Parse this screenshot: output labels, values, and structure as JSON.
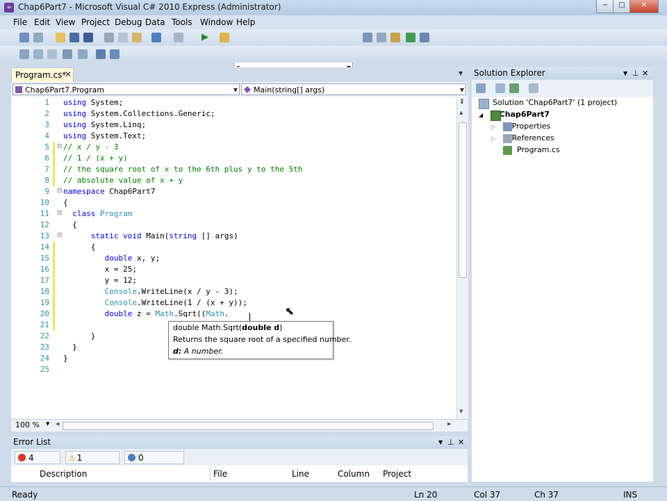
{
  "window": {
    "title": "Chap6Part7 - Microsoft Visual C# 2010 Express (Administrator)",
    "minimize_glyph": "−",
    "maximize_glyph": "□",
    "close_glyph": "✕"
  },
  "menu": [
    "File",
    "Edit",
    "View",
    "Project",
    "Debug",
    "Data",
    "Tools",
    "Window",
    "Help"
  ],
  "toolbar": {
    "find_combo_value": "c"
  },
  "document": {
    "tab_label": "Program.cs*",
    "tab_close": "✕",
    "type_dropdown": "Chap6Part7.Program",
    "member_dropdown": "Main(string[] args)",
    "zoom": "100 %"
  },
  "code_lines": [
    {
      "n": "1",
      "parts": [
        [
          "kw",
          "using"
        ],
        [
          "",
          "System;"
        ]
      ]
    },
    {
      "n": "2",
      "parts": [
        [
          "kw",
          "using"
        ],
        [
          "",
          "System.Collections.Generic;"
        ]
      ]
    },
    {
      "n": "3",
      "parts": [
        [
          "kw",
          "using"
        ],
        [
          "",
          "System.Linq;"
        ]
      ]
    },
    {
      "n": "4",
      "parts": [
        [
          "kw",
          "using"
        ],
        [
          "",
          "System.Text;"
        ]
      ]
    },
    {
      "n": "5",
      "parts": [
        [
          "cm",
          "// x / y - 3"
        ]
      ]
    },
    {
      "n": "6",
      "parts": [
        [
          "cm",
          "// 1 / (x + y)"
        ]
      ]
    },
    {
      "n": "7",
      "parts": [
        [
          "cm",
          "// the square root of x to the 6th plus y to the 5th"
        ]
      ]
    },
    {
      "n": "8",
      "parts": [
        [
          "cm",
          "// absolute value of x + y"
        ]
      ]
    },
    {
      "n": "9",
      "parts": [
        [
          "kw",
          "namespace"
        ],
        [
          "",
          " Chap6Part7"
        ]
      ]
    },
    {
      "n": "10",
      "parts": [
        [
          "",
          "{"
        ]
      ]
    },
    {
      "n": "11",
      "parts": [
        [
          "",
          "  "
        ],
        [
          "kw",
          "class"
        ],
        [
          "ty",
          " Program"
        ]
      ]
    },
    {
      "n": "12",
      "parts": [
        [
          "",
          "  {"
        ]
      ]
    },
    {
      "n": "13",
      "parts": [
        [
          "",
          "      "
        ],
        [
          "kw",
          "static void"
        ],
        [
          "",
          " Main("
        ],
        [
          "kw",
          "string"
        ],
        [
          "",
          "[] args)"
        ]
      ]
    },
    {
      "n": "14",
      "parts": [
        [
          "",
          "      {"
        ]
      ]
    },
    {
      "n": "15",
      "parts": [
        [
          "",
          "         "
        ],
        [
          "kw",
          "double"
        ],
        [
          "",
          " x, y;"
        ]
      ]
    },
    {
      "n": "16",
      "parts": [
        [
          "",
          "         x = 25;"
        ]
      ]
    },
    {
      "n": "17",
      "parts": [
        [
          "",
          "         y = 12;"
        ]
      ]
    },
    {
      "n": "18",
      "parts": [
        [
          "",
          "         "
        ],
        [
          "ty",
          "Console"
        ],
        [
          "",
          ".WriteLine(x / y - 3);"
        ]
      ]
    },
    {
      "n": "19",
      "parts": [
        [
          "",
          "         "
        ],
        [
          "ty",
          "Console"
        ],
        [
          "",
          ".WriteLine(1 / (x + y));"
        ]
      ]
    },
    {
      "n": "20",
      "parts": [
        [
          "",
          "         "
        ],
        [
          "kw",
          "double"
        ],
        [
          "",
          " z = "
        ],
        [
          "ty",
          "Math"
        ],
        [
          "",
          ".Sqrt(("
        ],
        [
          "ty",
          "Math"
        ],
        [
          "",
          "."
        ]
      ]
    },
    {
      "n": "21",
      "parts": [
        [
          "",
          ""
        ]
      ]
    },
    {
      "n": "22",
      "parts": [
        [
          "",
          "      }"
        ]
      ]
    },
    {
      "n": "23",
      "parts": [
        [
          "",
          "  }"
        ]
      ]
    },
    {
      "n": "24",
      "parts": [
        [
          "",
          "}"
        ]
      ]
    },
    {
      "n": "25",
      "parts": [
        [
          "",
          ""
        ]
      ]
    }
  ],
  "tooltip": {
    "signature_prefix": "double Math.Sqrt(",
    "signature_param": "double d",
    "signature_suffix": ")",
    "description": "Returns the square root of a specified number.",
    "param_name": "d:",
    "param_desc": " A number."
  },
  "solution_explorer": {
    "title": "Solution Explorer",
    "solution": "Solution 'Chap6Part7' (1 project)",
    "project": "Chap6Part7",
    "items": [
      "Properties",
      "References",
      "Program.cs"
    ]
  },
  "error_list": {
    "title": "Error List",
    "errors": "4 Errors",
    "warnings": "1 Warning",
    "messages": "0 Messages",
    "columns": [
      "Description",
      "File",
      "Line",
      "Column",
      "Project"
    ]
  },
  "status": {
    "ready": "Ready",
    "line": "Ln 20",
    "col": "Col 37",
    "ch": "Ch 37",
    "mode": "INS"
  },
  "colors": {
    "keyword": "#0000ff",
    "comment": "#008000",
    "type": "#2b91af",
    "line_number": "#2b91af"
  }
}
